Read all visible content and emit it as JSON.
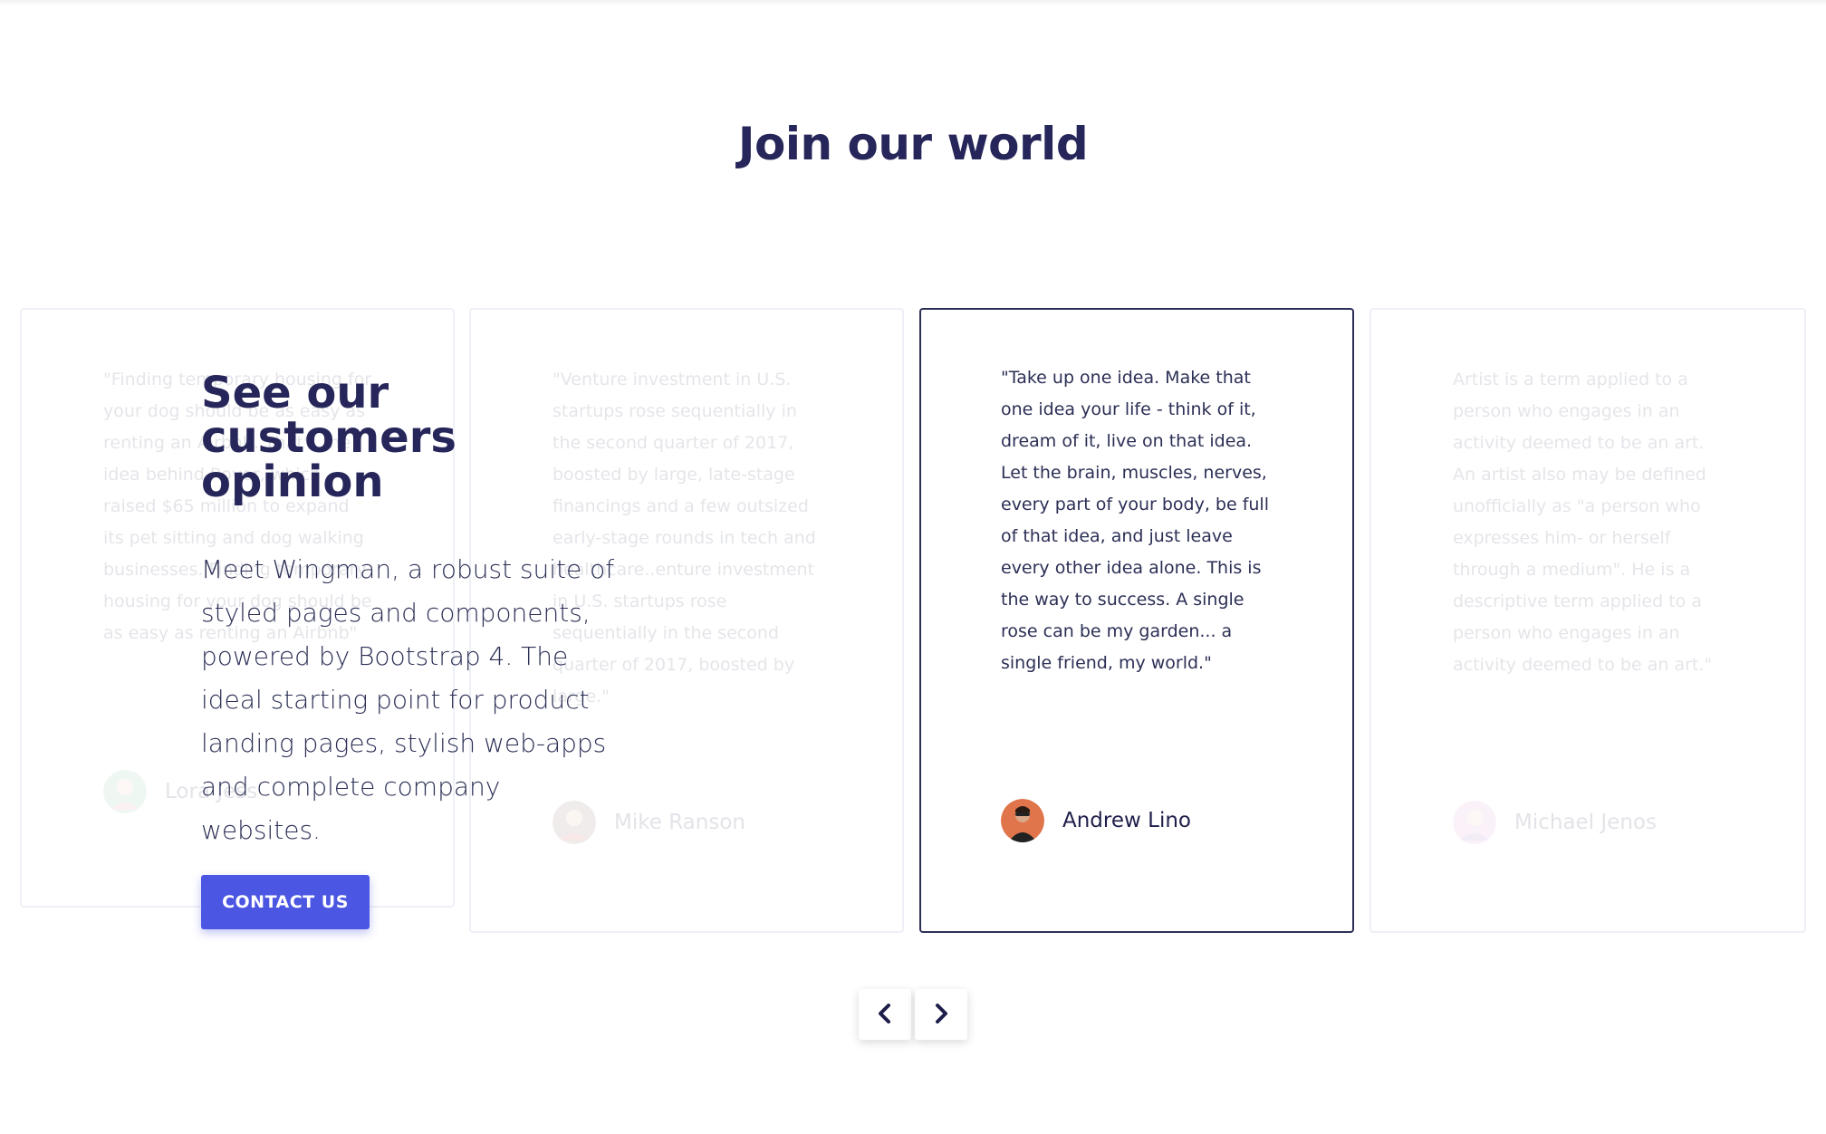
{
  "section": {
    "title": "Join our world"
  },
  "testimonials": [
    {
      "quote": "\"Finding temporary housing for your dog should be as easy as renting an Airbnb. That's the idea behind Rover, which raised $65 million to expand its pet sitting and dog walking businesses. Finding temporary housing for your dog should be as easy as renting an Airbnb\"",
      "author": "Lora Jess"
    },
    {
      "quote": "\"Venture investment in U.S. startups rose sequentially in the second quarter of 2017, boosted by large, late-stage financings and a few outsized early-stage rounds in tech and healthcare..enture investment in U.S. startups rose sequentially in the second quarter of 2017, boosted by large.\"",
      "author": "Mike Ranson"
    },
    {
      "quote": "\"Take up one idea. Make that one idea your life - think of it, dream of it, live on that idea. Let the brain, muscles, nerves, every part of your body, be full of that idea, and just leave every other idea alone. This is the way to success. A single rose can be my garden... a single friend, my world.\"",
      "author": "Andrew Lino"
    },
    {
      "quote": "Artist is a term applied to a person who engages in an activity deemed to be an art. An artist also may be defined unofficially as \"a person who expresses him- or herself through a medium\". He is a descriptive term applied to a person who engages in an activity deemed to be an art.\"",
      "author": "Michael Jenos"
    }
  ],
  "overlay": {
    "title": "See our customers opinion",
    "text": "Meet Wingman, a robust suite of styled pages and components, powered by Bootstrap 4. The ideal starting point for product landing pages, stylish web-apps and complete company websites.",
    "button_label": "CONTACT US"
  },
  "icons": {
    "prev": "chevron-left-icon",
    "next": "chevron-right-icon"
  },
  "colors": {
    "heading": "#26265a",
    "accent": "#4b56e2",
    "active_border": "#2b2f55"
  }
}
